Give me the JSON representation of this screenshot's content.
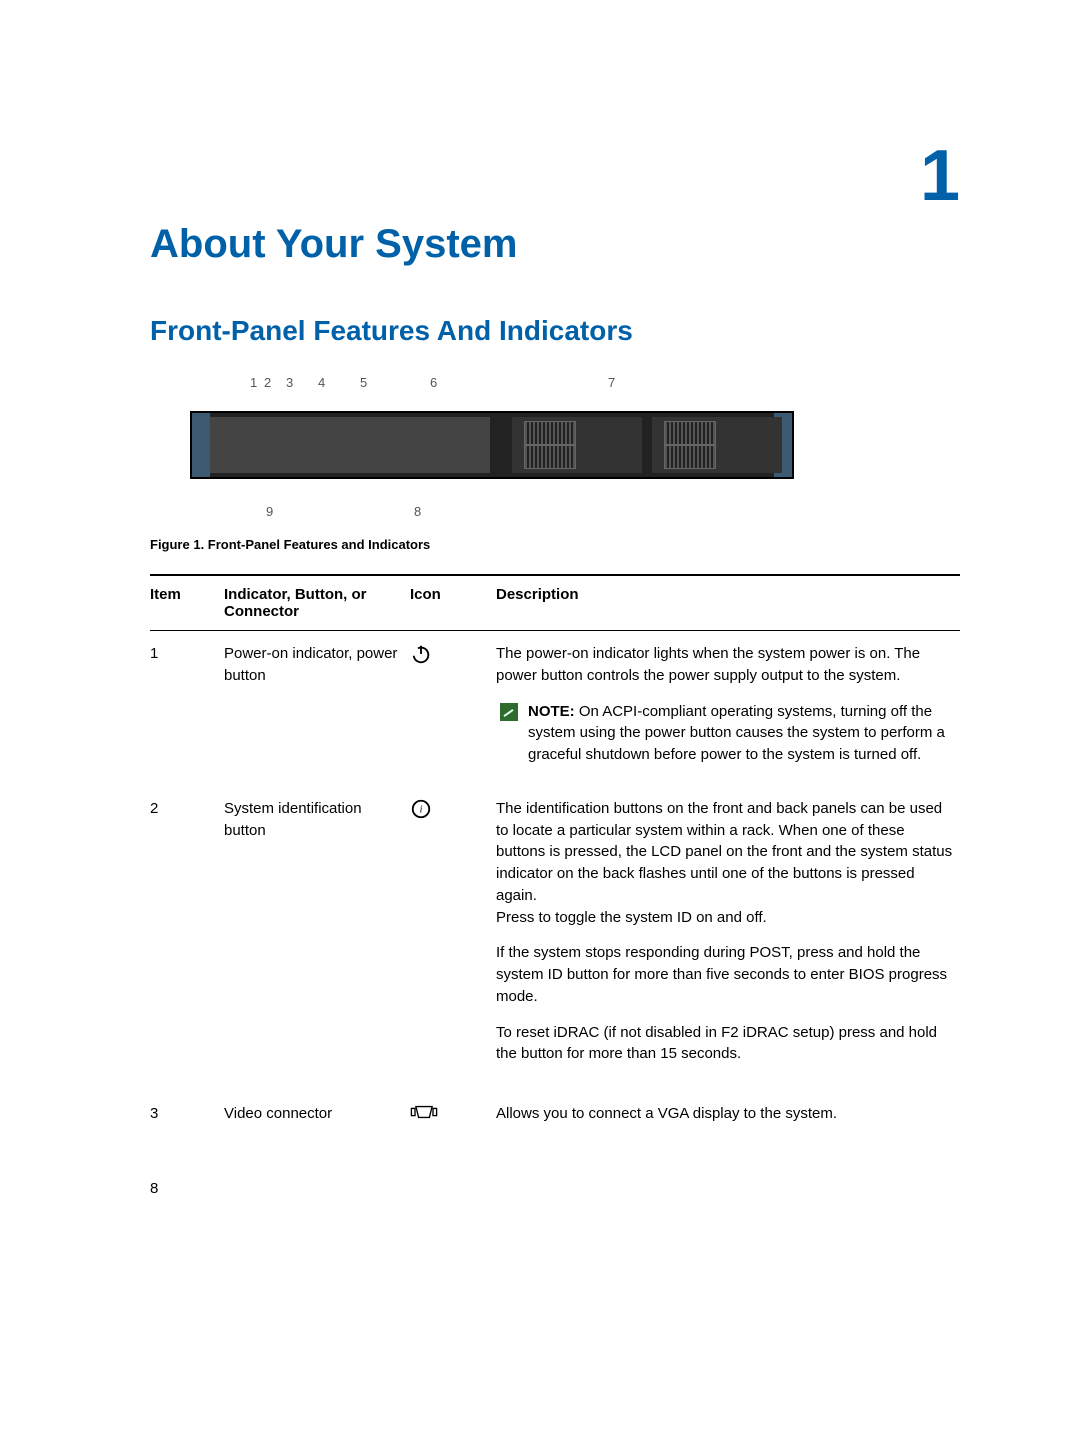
{
  "chapter_number": "1",
  "page_title": "About Your System",
  "section_title": "Front-Panel Features And Indicators",
  "figure_caption": "Figure 1. Front-Panel Features and Indicators",
  "callouts": {
    "top": [
      "1",
      "2",
      "3",
      "4",
      "5",
      "6",
      "7"
    ],
    "bottom_left": "9",
    "bottom_right": "8"
  },
  "table": {
    "headers": {
      "item": "Item",
      "indicator": "Indicator, Button, or Connector",
      "icon": "Icon",
      "description": "Description"
    },
    "rows": [
      {
        "item": "1",
        "name": "Power-on indicator, power button",
        "icon": "power-icon",
        "desc": "The power-on indicator lights when the system power is on. The power button controls the power supply output to the system.",
        "note_label": "NOTE:",
        "note": "On ACPI-compliant operating systems, turning off the system using the power button causes the system to perform a graceful shutdown before power to the system is turned off."
      },
      {
        "item": "2",
        "name": "System identification button",
        "icon": "id-icon",
        "desc_p1": "The identification buttons on the front and back panels can be used to locate a particular system within a rack. When one of these buttons is pressed, the LCD panel on the front and the system status indicator on the back flashes until one of the buttons is pressed again.",
        "desc_p1b": "Press to toggle the system ID on and off.",
        "desc_p2": "If the system stops responding during POST, press and hold the system ID button for more than five seconds to enter BIOS progress mode.",
        "desc_p3": "To reset iDRAC (if not disabled in F2 iDRAC setup) press and hold the button for more than 15 seconds."
      },
      {
        "item": "3",
        "name": "Video connector",
        "icon": "vga-icon",
        "desc": "Allows you to connect a VGA display to the system."
      }
    ]
  },
  "page_number": "8"
}
